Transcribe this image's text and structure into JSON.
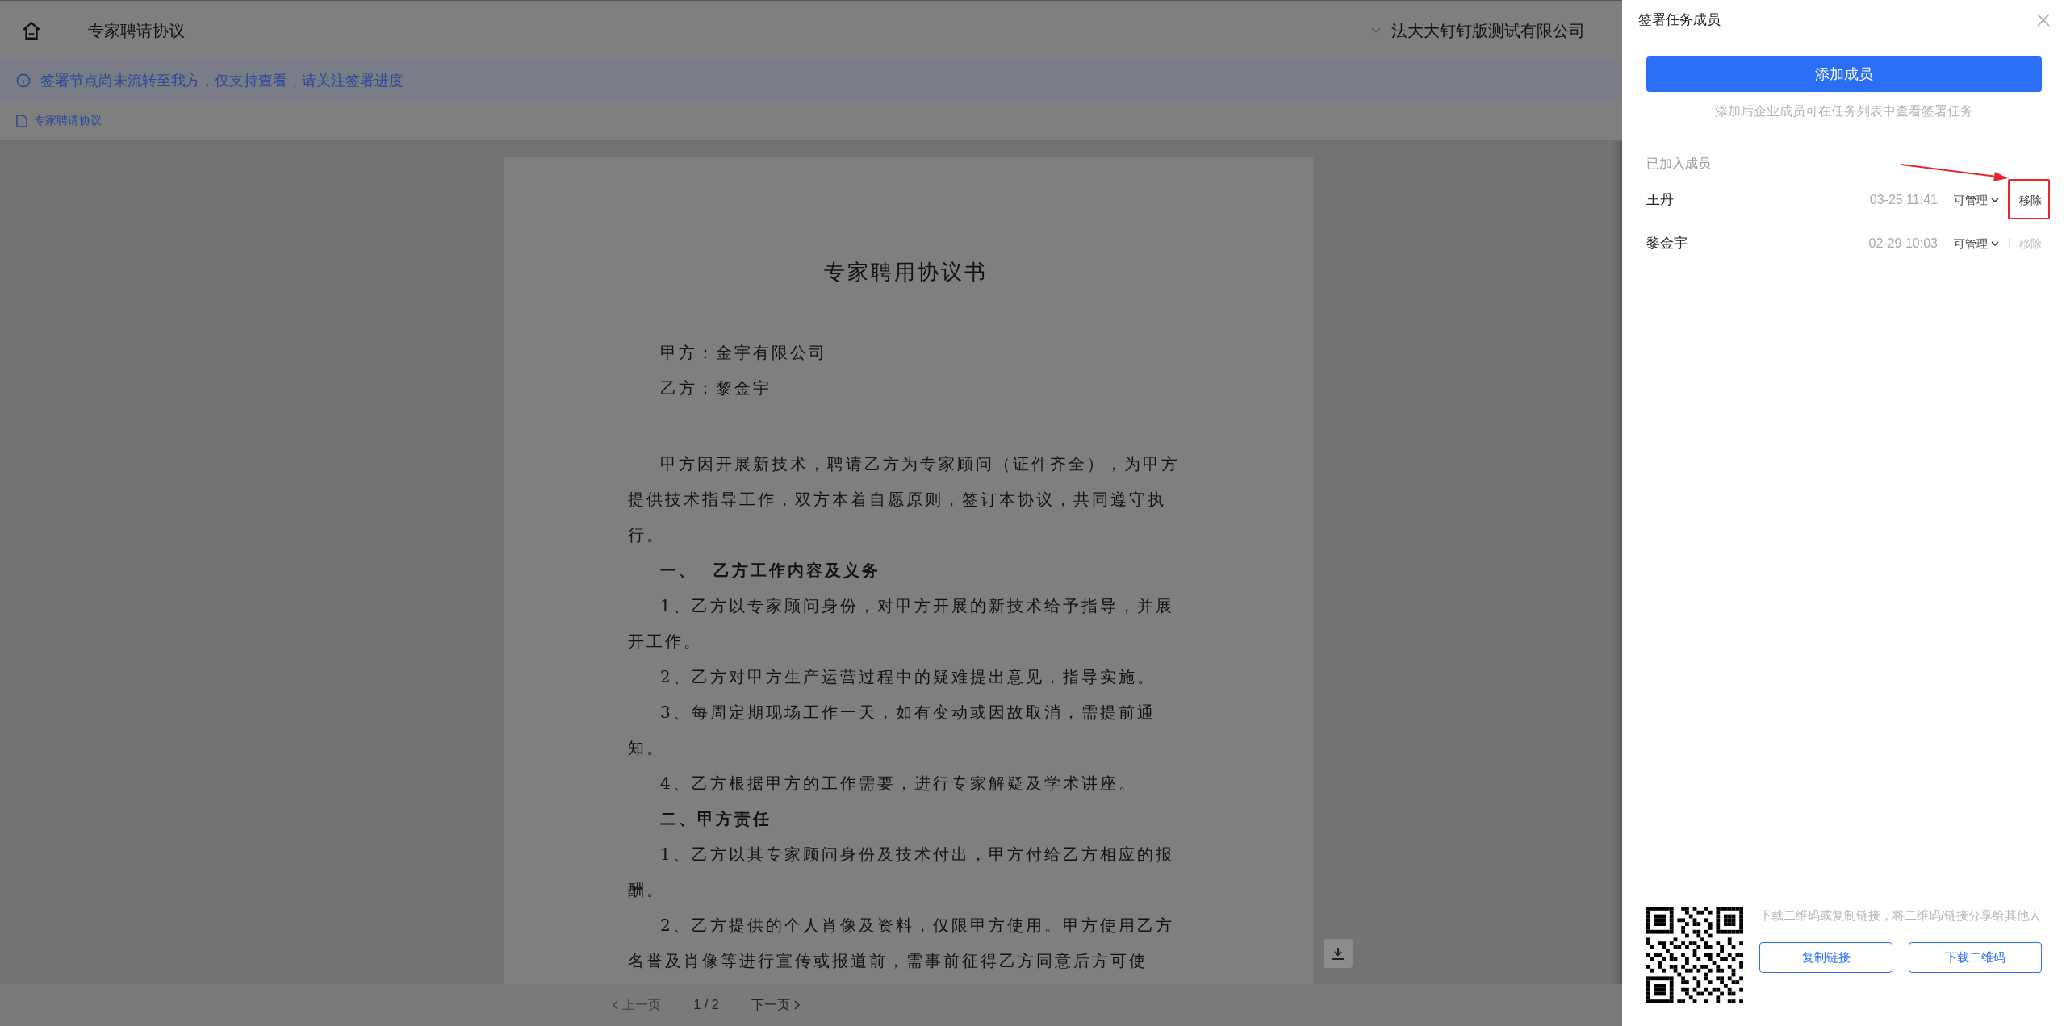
{
  "header": {
    "title": "专家聘请协议",
    "company": "法大大钉钉版测试有限公司"
  },
  "notice": {
    "text": "签署节点尚未流转至我方，仅支持查看，请关注签署进度"
  },
  "file_tab": {
    "label": "专家聘请协议"
  },
  "document": {
    "title": "专家聘用协议书",
    "paragraphs": [
      {
        "kind": "party",
        "text": "甲方：金宇有限公司"
      },
      {
        "kind": "party",
        "text": "乙方：黎金宇"
      },
      {
        "kind": "spacer_body",
        "text": "甲方因开展新技术，聘请乙方为专家顾问（证件齐全），为甲方提供技术指导工作，双方本着自愿原则，签订本协议，共同遵守执行。"
      },
      {
        "kind": "heading",
        "text": "一、  乙方工作内容及义务"
      },
      {
        "kind": "body",
        "text": "1、乙方以专家顾问身份，对甲方开展的新技术给予指导，并展开工作。"
      },
      {
        "kind": "body",
        "text": "2、乙方对甲方生产运营过程中的疑难提出意见，指导实施。"
      },
      {
        "kind": "body",
        "text": "3、每周定期现场工作一天，如有变动或因故取消，需提前通知。"
      },
      {
        "kind": "body",
        "text": "4、乙方根据甲方的工作需要，进行专家解疑及学术讲座。"
      },
      {
        "kind": "heading",
        "text": "二、甲方责任"
      },
      {
        "kind": "body",
        "text": "1、乙方以其专家顾问身份及技术付出，甲方付给乙方相应的报酬。"
      },
      {
        "kind": "body",
        "text": "2、乙方提供的个人肖像及资料，仅限甲方使用。甲方使用乙方名誉及肖像等进行宣传或报道前，需事前征得乙方同意后方可使"
      }
    ]
  },
  "pager": {
    "previous": "上一页",
    "previous_disabled": true,
    "page": "1 / 2",
    "next": "下一页"
  },
  "panel": {
    "title": "签署任务成员",
    "add_button": "添加成员",
    "hint": "添加后企业成员可在任务列表中查看签署任务",
    "members_label": "已加入成员",
    "members": [
      {
        "name": "王丹",
        "time": "03-25 11:41",
        "permission": "可管理",
        "remove": "移除",
        "remove_disabled": false,
        "highlighted": true
      },
      {
        "name": "黎金宇",
        "time": "02-29 10:03",
        "permission": "可管理",
        "remove": "移除",
        "remove_disabled": true,
        "highlighted": false
      }
    ],
    "share_text": "下载二维码或复制链接，将二维码/链接分享给其他人",
    "buttons": [
      "复制链接",
      "下载二维码"
    ]
  }
}
